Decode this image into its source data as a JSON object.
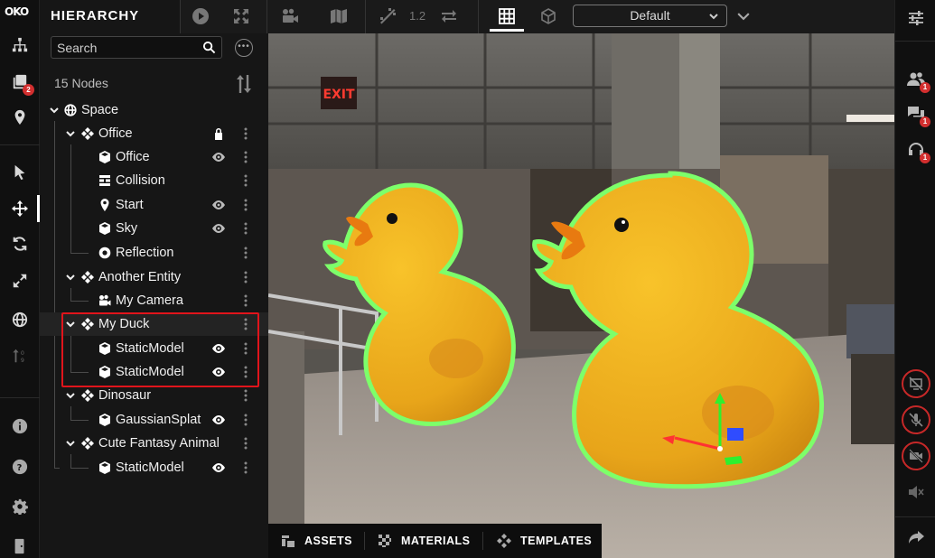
{
  "app": {
    "logo_text": "OKO"
  },
  "rail": {
    "assets_badge": "2"
  },
  "hierarchy": {
    "title": "HIERARCHY",
    "search_placeholder": "Search",
    "node_count": "15 Nodes",
    "nodes": [
      {
        "label": "Space",
        "icon": "globe-icon"
      },
      {
        "label": "Office",
        "icon": "entity-icon",
        "locked": true
      },
      {
        "label": "Office",
        "icon": "cube-icon",
        "visible": true
      },
      {
        "label": "Collision",
        "icon": "collision-icon"
      },
      {
        "label": "Start",
        "icon": "pin-icon",
        "visible": true
      },
      {
        "label": "Sky",
        "icon": "cube-icon",
        "visible": true
      },
      {
        "label": "Reflection",
        "icon": "reflection-icon"
      },
      {
        "label": "Another Entity",
        "icon": "entity-icon"
      },
      {
        "label": "My Camera",
        "icon": "camera-icon"
      },
      {
        "label": "My Duck",
        "icon": "entity-icon",
        "selected": true
      },
      {
        "label": "StaticModel",
        "icon": "cube-icon",
        "visible": true
      },
      {
        "label": "StaticModel",
        "icon": "cube-icon",
        "visible": true
      },
      {
        "label": "Dinosaur",
        "icon": "entity-icon"
      },
      {
        "label": "GaussianSplat",
        "icon": "cube-icon",
        "visible": true
      },
      {
        "label": "Cute Fantasy Animal",
        "icon": "entity-icon"
      },
      {
        "label": "StaticModel",
        "icon": "cube-icon",
        "visible": true
      }
    ]
  },
  "toolbar": {
    "zoom_value": "1.2",
    "camera_preset": "Default"
  },
  "viewport": {
    "exit_sign": "EXIT",
    "highlight_color": "#7dff6a",
    "duck_color": "#f2b01e"
  },
  "bottom_tabs": [
    {
      "label": "ASSETS",
      "icon": "assets-icon"
    },
    {
      "label": "MATERIALS",
      "icon": "materials-icon"
    },
    {
      "label": "TEMPLATES",
      "icon": "templates-icon"
    }
  ],
  "right_rail": {
    "users_badge": "1",
    "chat_badge": "1",
    "audio_badge": "1"
  }
}
